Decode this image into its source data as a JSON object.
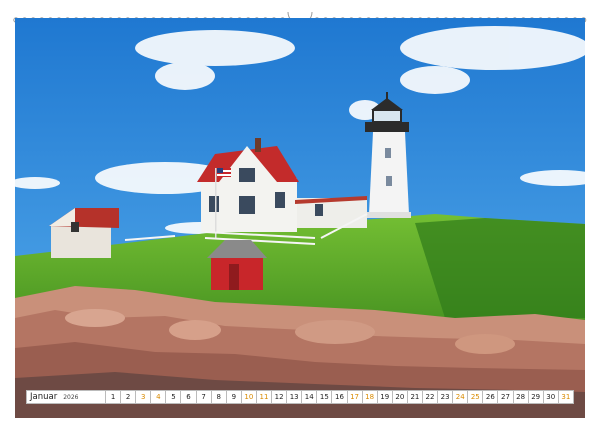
{
  "calendar": {
    "month": "Januar",
    "year": "2026",
    "days": [
      "1",
      "2",
      "3",
      "4",
      "5",
      "6",
      "7",
      "8",
      "9",
      "10",
      "11",
      "12",
      "13",
      "14",
      "15",
      "16",
      "17",
      "18",
      "19",
      "20",
      "21",
      "22",
      "23",
      "24",
      "25",
      "26",
      "27",
      "28",
      "29",
      "30",
      "31"
    ],
    "weekend_days": [
      "3",
      "4",
      "10",
      "11",
      "17",
      "18",
      "24",
      "25",
      "31"
    ]
  },
  "colors": {
    "sky": "#2f8ee0",
    "grass": "#5fae2a",
    "lighthouse": "#f4f4f4",
    "roof_red": "#c8262a",
    "rock": "#c9907a",
    "weekend": "#d98a00"
  }
}
